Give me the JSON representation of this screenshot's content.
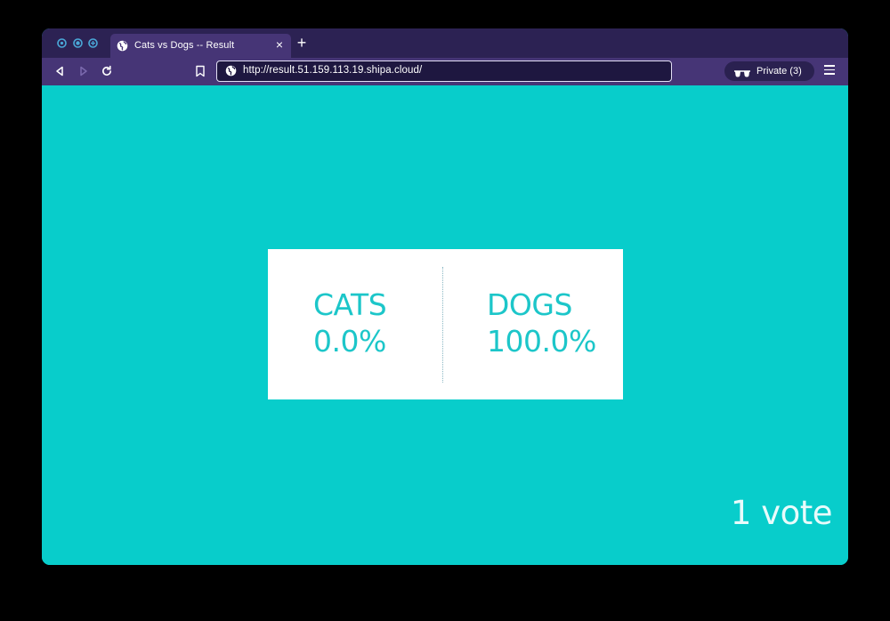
{
  "browser": {
    "tab": {
      "title": "Cats vs Dogs -- Result",
      "close_glyph": "×"
    },
    "new_tab_glyph": "+",
    "url": "http://result.51.159.113.19.shipa.cloud/",
    "private": {
      "label": "Private (3)",
      "icon": "incognito-glasses-icon"
    },
    "colors": {
      "tabstrip": "#2c2253",
      "toolbar": "#463576",
      "traffic": "#4aa8d8"
    }
  },
  "page": {
    "background": "#08cdcb",
    "accent": "#1cc6c9",
    "results": [
      {
        "name": "CATS",
        "percent": "0.0%"
      },
      {
        "name": "DOGS",
        "percent": "100.0%"
      }
    ],
    "vote_count": "1 vote"
  }
}
